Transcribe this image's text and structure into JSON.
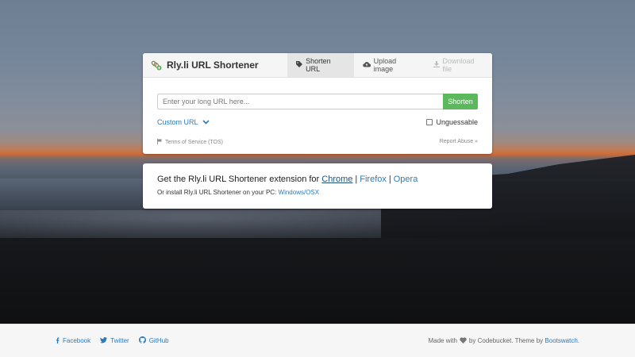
{
  "app": {
    "brand_title": "Rly.li URL Shortener"
  },
  "tabs": [
    {
      "label": "Shorten URL",
      "icon": "tag-icon",
      "state": "active"
    },
    {
      "label": "Upload image",
      "icon": "cloud-upload-icon",
      "state": "normal"
    },
    {
      "label": "Download file",
      "icon": "download-icon",
      "state": "disabled"
    }
  ],
  "form": {
    "url_placeholder": "Enter your long URL here...",
    "url_value": "",
    "shorten_label": "Shorten",
    "custom_url_label": "Custom URL",
    "unguessable_label": "Unguessable",
    "unguessable_checked": false,
    "tos_label": "Terms of Service (TOS)",
    "report_abuse_label": "Report Abuse »"
  },
  "extension": {
    "text": "Get the Rly.li URL Shortener extension for",
    "chrome": "Chrome",
    "firefox": "Firefox",
    "opera": "Opera",
    "separator": "|",
    "install_text": "Or install Rly.li URL Shortener on your PC:",
    "install_link": "Windows/OSX"
  },
  "footer": {
    "social": [
      {
        "label": "Facebook",
        "icon": "facebook-icon"
      },
      {
        "label": "Twitter",
        "icon": "twitter-icon"
      },
      {
        "label": "GitHub",
        "icon": "github-icon"
      }
    ],
    "made_with": "Made with",
    "by_text": "by Codebucket. Theme by",
    "theme_link": "Bootswatch",
    "period": "."
  },
  "colors": {
    "accent_link": "#2b7bb9",
    "shorten_button": "#5cb85c"
  }
}
